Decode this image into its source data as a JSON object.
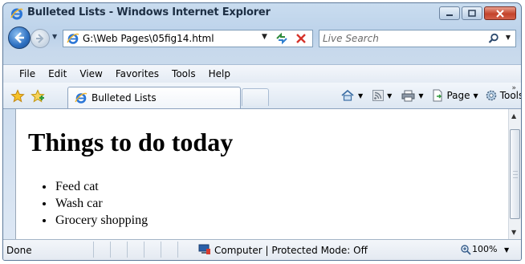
{
  "window": {
    "title": "Bulleted Lists - Windows Internet Explorer"
  },
  "address_bar": {
    "url": "G:\\Web Pages\\05fig14.html"
  },
  "search": {
    "placeholder": "Live Search"
  },
  "menu": {
    "items": [
      "File",
      "Edit",
      "View",
      "Favorites",
      "Tools",
      "Help"
    ]
  },
  "tabs": {
    "active_label": "Bulleted Lists"
  },
  "command_bar": {
    "page_label": "Page",
    "tools_label": "Tools"
  },
  "page": {
    "heading": "Things to do today",
    "list_items": [
      "Feed cat",
      "Wash car",
      "Grocery shopping"
    ]
  },
  "status_bar": {
    "status": "Done",
    "zone": "Computer | Protected Mode: Off",
    "zoom": "100%"
  },
  "colors": {
    "chrome_blue": "#bcd2ea",
    "close_red": "#c4432b"
  },
  "icons": [
    "ie-logo-icon",
    "minimize-icon",
    "maximize-icon",
    "close-icon",
    "back-icon",
    "forward-icon",
    "refresh-icon",
    "stop-icon",
    "search-icon",
    "favorites-star-icon",
    "add-favorites-icon",
    "home-icon",
    "feeds-icon",
    "print-icon",
    "page-icon",
    "tools-gear-icon",
    "computer-zone-icon",
    "zoom-icon"
  ]
}
